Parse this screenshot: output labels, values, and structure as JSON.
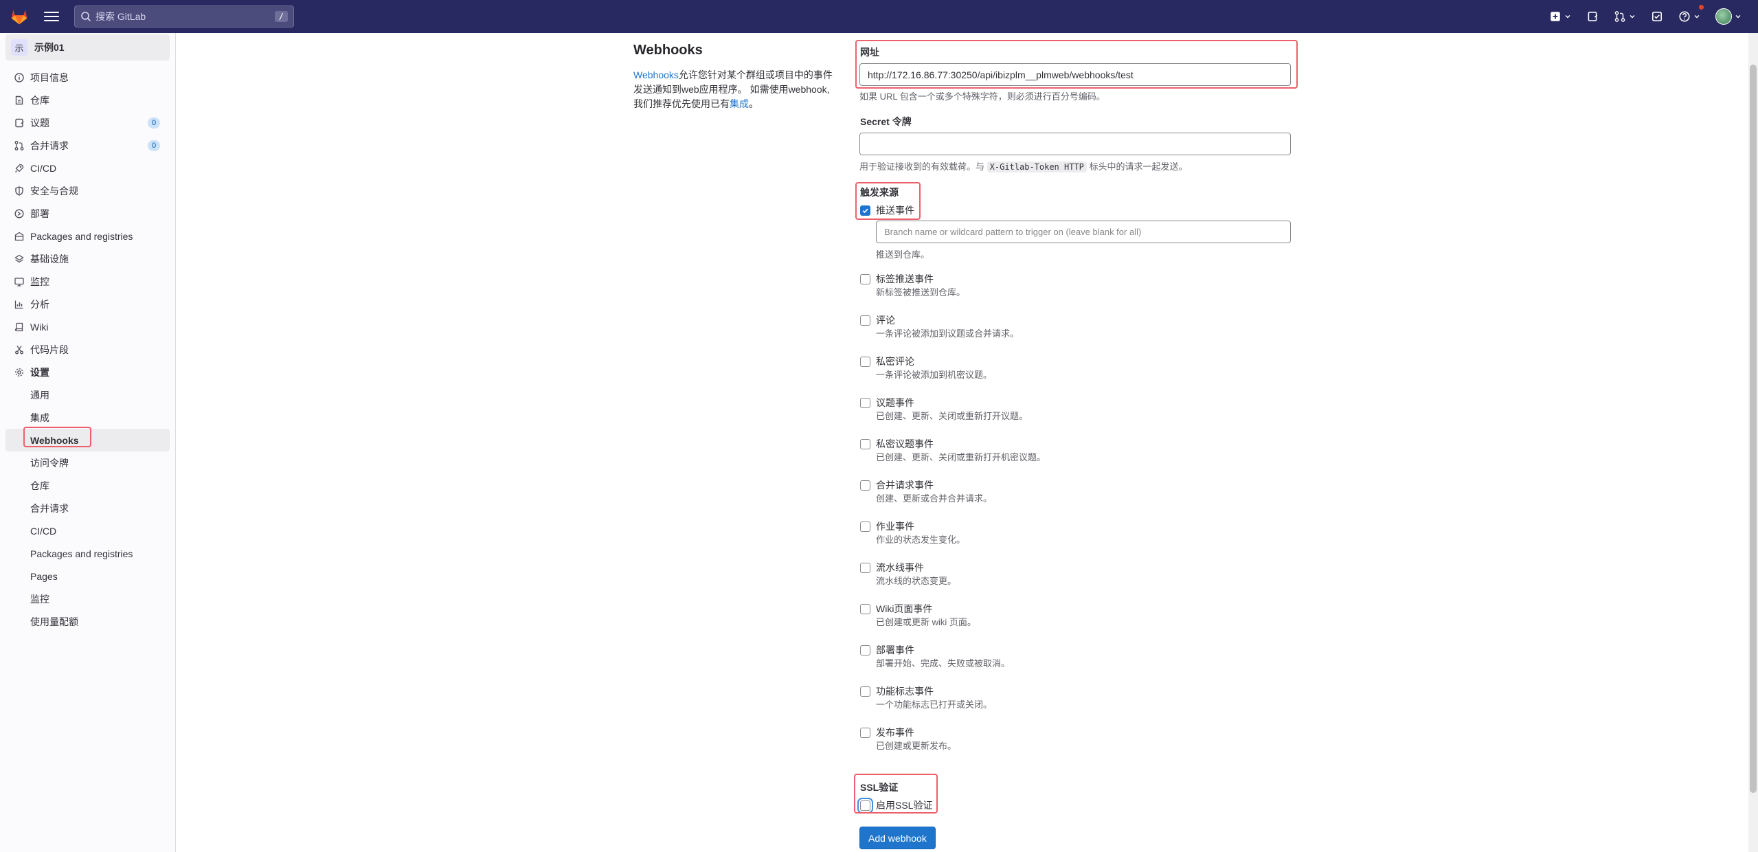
{
  "search": {
    "placeholder": "搜索 GitLab",
    "shortcut": "/"
  },
  "project": {
    "avatar_letter": "示",
    "name": "示例01"
  },
  "sidebar": {
    "items": [
      {
        "label": "项目信息",
        "icon": "info-icon"
      },
      {
        "label": "仓库",
        "icon": "repository-icon"
      },
      {
        "label": "议题",
        "icon": "issues-icon",
        "badge": "0"
      },
      {
        "label": "合并请求",
        "icon": "merge-request-icon",
        "badge": "0"
      },
      {
        "label": "CI/CD",
        "icon": "rocket-icon"
      },
      {
        "label": "安全与合规",
        "icon": "shield-icon"
      },
      {
        "label": "部署",
        "icon": "deployments-icon"
      },
      {
        "label": "Packages and registries",
        "icon": "package-icon"
      },
      {
        "label": "基础设施",
        "icon": "cloud-icon"
      },
      {
        "label": "监控",
        "icon": "monitor-icon"
      },
      {
        "label": "分析",
        "icon": "chart-icon"
      },
      {
        "label": "Wiki",
        "icon": "book-icon"
      },
      {
        "label": "代码片段",
        "icon": "snippet-icon"
      },
      {
        "label": "设置",
        "icon": "gear-icon"
      }
    ],
    "settings_sub": [
      "通用",
      "集成",
      "Webhooks",
      "访问令牌",
      "仓库",
      "合并请求",
      "CI/CD",
      "Packages and registries",
      "Pages",
      "监控",
      "使用量配额"
    ]
  },
  "intro": {
    "title": "Webhooks",
    "link": "Webhooks",
    "text1": "允许您针对某个群组或项目中的事件发送通知到web应用程序。 如需使用webhook, 我们推荐优先使用已有",
    "link2": "集成",
    "text2": "。"
  },
  "form": {
    "url_label": "网址",
    "url_value": "http://172.16.86.77:30250/api/ibizplm__plmweb/webhooks/test",
    "url_help": "如果 URL 包含一个或多个特殊字符，则必须进行百分号编码。",
    "secret_label": "Secret 令牌",
    "secret_help_pre": "用于验证接收到的有效载荷。与",
    "secret_help_code": "X-Gitlab-Token HTTP",
    "secret_help_post": "标头中的请求一起发送。",
    "trigger_label": "触发来源",
    "push_label": "推送事件",
    "branch_placeholder": "Branch name or wildcard pattern to trigger on (leave blank for all)",
    "push_desc": "推送到仓库。",
    "events": [
      {
        "label": "标签推送事件",
        "desc": "新标签被推送到仓库。"
      },
      {
        "label": "评论",
        "desc": "一条评论被添加到议题或合并请求。"
      },
      {
        "label": "私密评论",
        "desc": "一条评论被添加到机密议题。"
      },
      {
        "label": "议题事件",
        "desc": "已创建、更新、关闭或重新打开议题。"
      },
      {
        "label": "私密议题事件",
        "desc": "已创建、更新、关闭或重新打开机密议题。"
      },
      {
        "label": "合并请求事件",
        "desc": "创建、更新或合并合并请求。"
      },
      {
        "label": "作业事件",
        "desc": "作业的状态发生变化。"
      },
      {
        "label": "流水线事件",
        "desc": "流水线的状态变更。"
      },
      {
        "label": "Wiki页面事件",
        "desc": "已创建或更新 wiki 页面。"
      },
      {
        "label": "部署事件",
        "desc": "部署开始、完成、失败或被取消。"
      },
      {
        "label": "功能标志事件",
        "desc": "一个功能标志已打开或关闭。"
      },
      {
        "label": "发布事件",
        "desc": "已创建或更新发布。"
      }
    ],
    "ssl_label": "SSL验证",
    "ssl_checkbox": "启用SSL验证",
    "submit": "Add webhook"
  },
  "colors": {
    "topbar": "#292961",
    "primary": "#1f75cb",
    "highlight": "#ec5f6b"
  }
}
